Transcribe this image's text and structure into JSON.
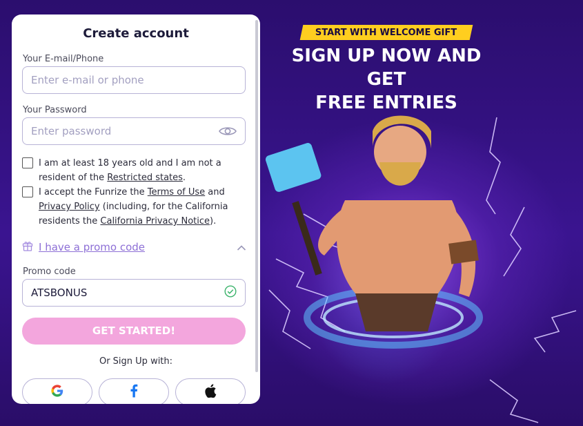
{
  "form": {
    "title": "Create account",
    "email_label": "Your E-mail/Phone",
    "email_placeholder": "Enter e-mail or phone",
    "password_label": "Your Password",
    "password_placeholder": "Enter password",
    "password_toggle_icon": "eye-icon",
    "age_check": {
      "text_before": "I am at least 18 years old and I am not a resident of the ",
      "link": "Restricted states",
      "text_after": "."
    },
    "terms_check": {
      "text_1": "I accept the Funrize the ",
      "link_terms": "Terms of Use",
      "text_2": " and ",
      "link_privacy": "Privacy Policy",
      "text_3": " (including, for the California residents the ",
      "link_california": "California Privacy Notice",
      "text_4": ")."
    },
    "promo_toggle": {
      "icon": "gift-icon",
      "label": "I have a promo code",
      "chevron": "chevron-up-icon"
    },
    "promo_label": "Promo code",
    "promo_value": "ATSBONUS",
    "promo_valid_icon": "check-circle-icon",
    "submit_label": "GET STARTED!",
    "or_text": "Or Sign Up with:",
    "social_buttons": [
      "google-icon",
      "facebook-icon",
      "apple-icon"
    ]
  },
  "promo": {
    "badge": "START WITH WELCOME GIFT",
    "headline_line1": "SIGN UP NOW AND",
    "headline_line2": "GET",
    "headline_line3": "FREE ENTRIES"
  },
  "colors": {
    "background": "#2a0f6b",
    "accent_yellow": "#ffce1f",
    "cta_pink": "#f3a6dd",
    "link_purple": "#8d6fd6",
    "valid_green": "#3bb36b"
  }
}
